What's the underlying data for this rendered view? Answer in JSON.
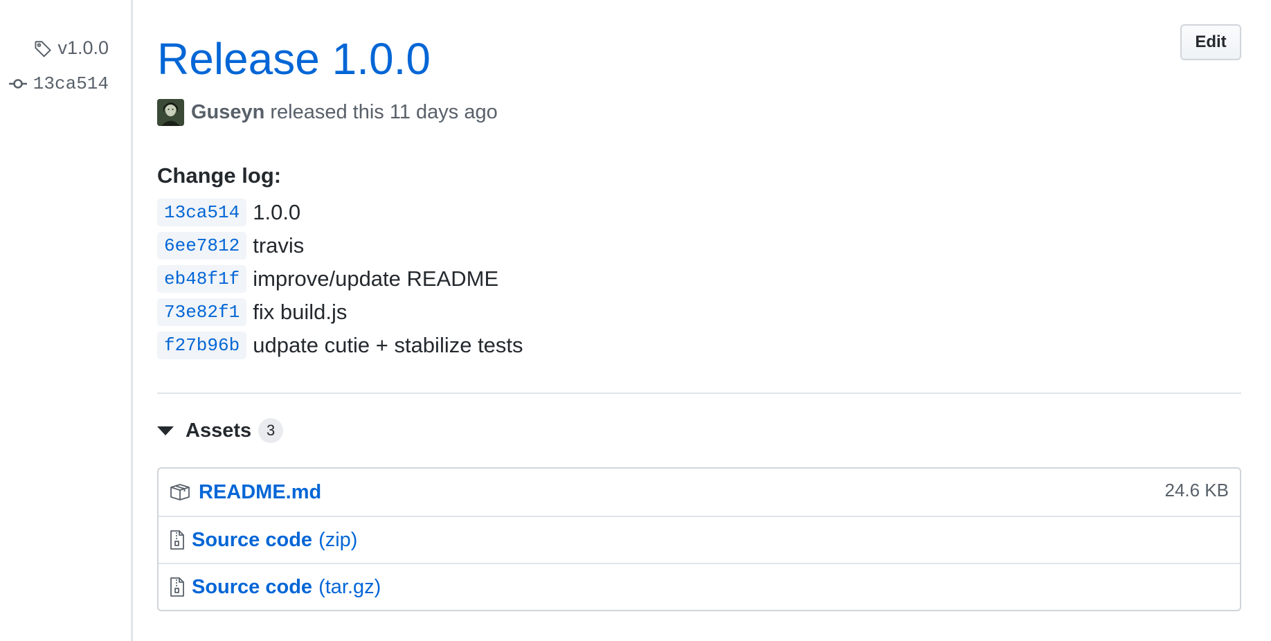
{
  "sidebar": {
    "tag": "v1.0.0",
    "commit": "13ca514"
  },
  "release": {
    "title": "Release 1.0.0",
    "edit_label": "Edit",
    "author": "Guseyn",
    "released_text": "released this 11 days ago"
  },
  "changelog": {
    "heading": "Change log:",
    "commits": [
      {
        "sha": "13ca514",
        "message": "1.0.0"
      },
      {
        "sha": "6ee7812",
        "message": "travis"
      },
      {
        "sha": "eb48f1f",
        "message": "improve/update README"
      },
      {
        "sha": "73e82f1",
        "message": "fix build.js"
      },
      {
        "sha": "f27b96b",
        "message": "udpate cutie + stabilize tests"
      }
    ]
  },
  "assets": {
    "label": "Assets",
    "count": "3",
    "items": [
      {
        "name": "README.md",
        "ext": "",
        "size": "24.6 KB",
        "icon": "package-icon"
      },
      {
        "name": "Source code",
        "ext": "(zip)",
        "size": "",
        "icon": "file-zip-icon"
      },
      {
        "name": "Source code",
        "ext": "(tar.gz)",
        "size": "",
        "icon": "file-zip-icon"
      }
    ]
  },
  "colors": {
    "link": "#0366d6",
    "text": "#24292e",
    "muted": "#586069",
    "border": "#e1e4e8"
  }
}
